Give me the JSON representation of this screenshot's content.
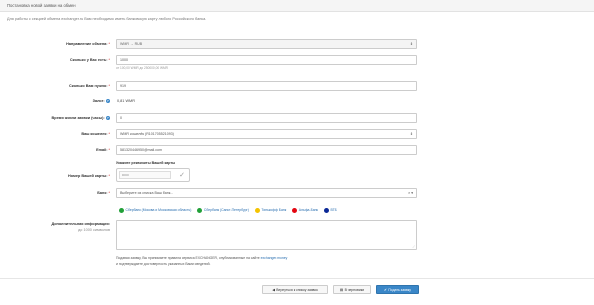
{
  "header": {
    "title": "Постановка новой заявки на обмен"
  },
  "intro": "Для работы с секцией обмена exchanger.ru Вам необходимо иметь банковскую карту любого Российского банка.",
  "form": {
    "direction": {
      "label": "Направление обмена:",
      "value": "WMR → RUB"
    },
    "amount": {
      "label": "Сколько у Вас есть:",
      "value": "1000",
      "hint": "от 100,00 WMR до 250000,00 WMR"
    },
    "receive": {
      "label": "Сколько Вам нужно:",
      "value": "919"
    },
    "deposit": {
      "label": "Залог:",
      "value": "0,81 WMR"
    },
    "lifetime": {
      "label": "Время жизни заявки (часы):",
      "value": "0"
    },
    "wallet": {
      "label": "Ваш кошелек:",
      "value": "WMR кошелёк (R101705521093)"
    },
    "email": {
      "label": "Email:",
      "value": "581320446950@mail.com"
    },
    "card_requisites_title": "Укажите реквизиты Вашей карты",
    "card": {
      "label": "Номер Вашей карты:",
      "value": "••••••"
    },
    "bank": {
      "label": "Банк:",
      "placeholder": "Выберите из списка Ваш банк...",
      "clear": "×",
      "arrow": "▾"
    },
    "banks": [
      {
        "name": "Сбербанк (Москва и Московская область)",
        "color": "#21a038"
      },
      {
        "name": "Сбербанк (Санкт-Петербург)",
        "color": "#21a038"
      },
      {
        "name": "Тинькофф Банк",
        "color": "#f4c300"
      },
      {
        "name": "Альфа-Банк",
        "color": "#e30611"
      },
      {
        "name": "ВТБ",
        "color": "#0a2896"
      }
    ],
    "additional": {
      "label": "Дополнительная информация:",
      "hint": "до 1000 символов"
    },
    "agree_line1_prefix": "Подавая заявку, Вы принимаете правила сервиса EXCHANGER, опубликованные на сайте ",
    "agree_link": "exchanger.money",
    "agree_line2": "и подтверждаете достоверность указанных Вами сведений."
  },
  "footer": {
    "back_label": "Вернуться к списку заявок",
    "draft_label": "В черновики",
    "submit_label": "Подать заявку"
  }
}
